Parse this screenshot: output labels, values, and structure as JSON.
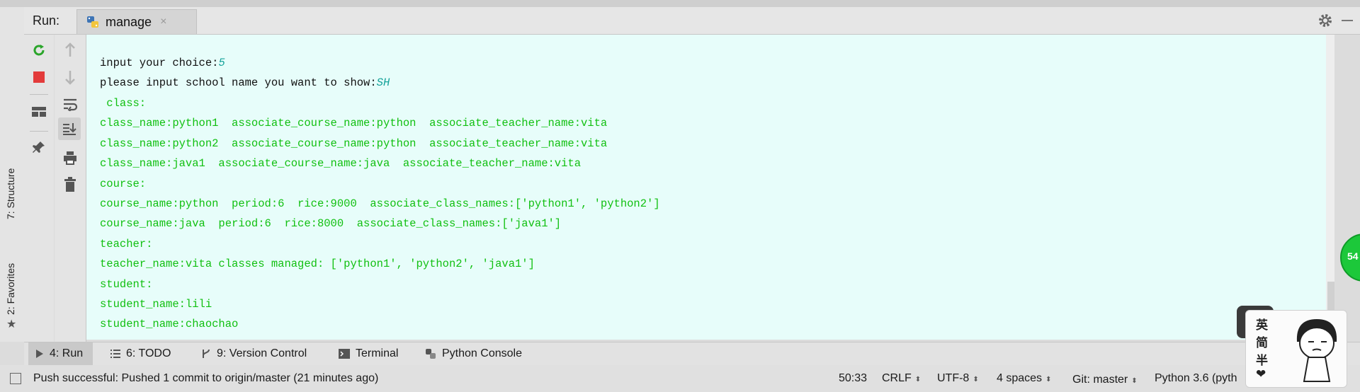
{
  "header": {
    "run_label": "Run:",
    "tab_label": "manage",
    "tab_close": "×"
  },
  "console_lines": [
    {
      "prompt": "input your choice:",
      "value": "5"
    },
    {
      "prompt": "please input school name you want to show:",
      "value": "SH"
    },
    {
      "text": " class:"
    },
    {
      "text": "class_name:python1  associate_course_name:python  associate_teacher_name:vita"
    },
    {
      "text": "class_name:python2  associate_course_name:python  associate_teacher_name:vita"
    },
    {
      "text": "class_name:java1  associate_course_name:java  associate_teacher_name:vita"
    },
    {
      "text": "course:"
    },
    {
      "text": "course_name:python  period:6  rice:9000  associate_class_names:['python1', 'python2']"
    },
    {
      "text": "course_name:java  period:6  rice:8000  associate_class_names:['java1']"
    },
    {
      "text": "teacher:"
    },
    {
      "text": "teacher_name:vita classes managed: ['python1', 'python2', 'java1']"
    },
    {
      "text": "student:"
    },
    {
      "text": "student_name:lili"
    },
    {
      "text": "student_name:chaochao"
    }
  ],
  "left_tabs": {
    "structure": "7: Structure",
    "favorites": "2: Favorites"
  },
  "bottom_tabs": {
    "run": "4: Run",
    "todo": "6: TODO",
    "version_control": "9: Version Control",
    "terminal": "Terminal",
    "python_console": "Python Console"
  },
  "status": {
    "message": "Push successful: Pushed 1 commit to origin/master (21 minutes ago)",
    "position": "50:33",
    "line_sep": "CRLF",
    "encoding": "UTF-8",
    "indent": "4 spaces",
    "git": "Git: master",
    "interpreter": "Python 3.6 (pyth"
  },
  "overlay": {
    "badge": "54",
    "sticker_chars": [
      "英",
      "简",
      "半",
      "❤"
    ]
  },
  "colors": {
    "console_bg": "#e7fdfa",
    "input_text": "#111111",
    "user_input": "#16a39a",
    "output_text": "#11c011"
  },
  "icons": [
    "rerun-icon",
    "stop-icon",
    "layout-icon",
    "pin-icon",
    "up-arrow-icon",
    "down-arrow-icon",
    "soft-wrap-icon",
    "scroll-to-end-icon",
    "print-icon",
    "trash-icon",
    "gear-icon",
    "python-icon"
  ]
}
